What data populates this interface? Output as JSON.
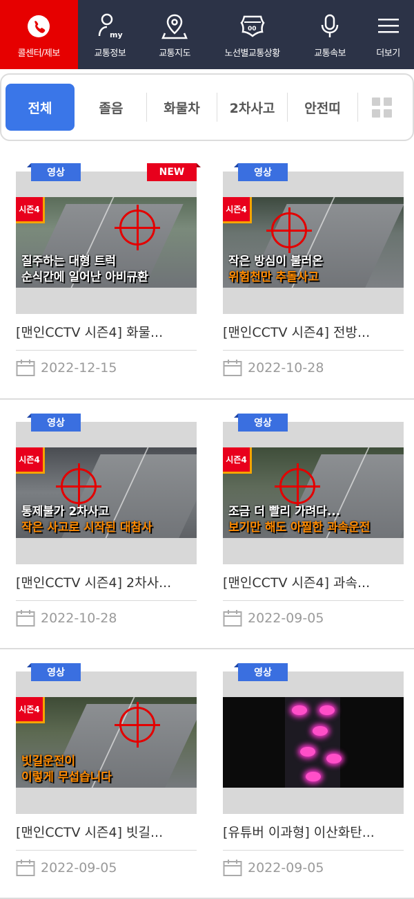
{
  "nav": [
    {
      "label": "콜센터/제보",
      "icon": "phone-icon"
    },
    {
      "label": "교통정보",
      "icon": "my-user-icon"
    },
    {
      "label": "교통지도",
      "icon": "map-pin-icon"
    },
    {
      "label": "노선별교통상황",
      "icon": "highway-shield-icon"
    },
    {
      "label": "교통속보",
      "icon": "microphone-icon"
    },
    {
      "label": "더보기",
      "icon": "menu-icon"
    }
  ],
  "tabs": [
    "전체",
    "졸음",
    "화물차",
    "2차사고",
    "안전띠"
  ],
  "colors": {
    "accent": "#3a76e8",
    "nav_bg": "#2c3347",
    "call_bg": "#e60000",
    "new_badge": "#e8001c",
    "video_badge": "#3a6fe0"
  },
  "cards": [
    {
      "badge": "영상",
      "new": "NEW",
      "season": "시즌4",
      "caption1": "질주하는 대형 트럭",
      "caption2": "순식간에 일어난 아비규환",
      "title": "[맨인CCTV 시즌4] 화물...",
      "date": "2022-12-15"
    },
    {
      "badge": "영상",
      "season": "시즌4",
      "caption1": "작은 방심이 불러온",
      "caption2": "위험천만 추돌사고",
      "title": "[맨인CCTV 시즌4] 전방...",
      "date": "2022-10-28"
    },
    {
      "badge": "영상",
      "season": "시즌4",
      "caption1": "통제불가 2차사고",
      "caption2": "작은 사고로 시작된 대참사",
      "title": "[맨인CCTV 시즌4] 2차사...",
      "date": "2022-10-28"
    },
    {
      "badge": "영상",
      "season": "시즌4",
      "caption1": "조금 더 빨리 가려다...",
      "caption2": "보기만 해도 아찔한 과속운전",
      "title": "[맨인CCTV 시즌4] 과속...",
      "date": "2022-09-05"
    },
    {
      "badge": "영상",
      "season": "시즌4",
      "caption1": "빗길운전이",
      "caption2": "이렇게 무섭습니다",
      "title": "[맨인CCTV 시즌4] 빗길...",
      "date": "2022-09-05"
    },
    {
      "badge": "영상",
      "title": "[유튜버 이과형] 이산화탄...",
      "date": "2022-09-05"
    }
  ]
}
